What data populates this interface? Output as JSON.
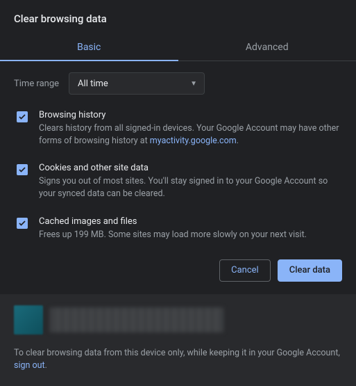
{
  "title": "Clear browsing data",
  "tabs": {
    "basic": "Basic",
    "advanced": "Advanced"
  },
  "timerange": {
    "label": "Time range",
    "value": "All time"
  },
  "options": {
    "history": {
      "title": "Browsing history",
      "desc1": "Clears history from all signed-in devices. Your Google Account may have other forms of browsing history at ",
      "link": "myactivity.google.com",
      "desc2": "."
    },
    "cookies": {
      "title": "Cookies and other site data",
      "desc": "Signs you out of most sites. You'll stay signed in to your Google Account so your synced data can be cleared."
    },
    "cache": {
      "title": "Cached images and files",
      "desc": "Frees up 199 MB. Some sites may load more slowly on your next visit."
    }
  },
  "buttons": {
    "cancel": "Cancel",
    "clear": "Clear data"
  },
  "footer": {
    "note1": "To clear browsing data from this device only, while keeping it in your Google Account, ",
    "signout": "sign out",
    "note2": "."
  }
}
